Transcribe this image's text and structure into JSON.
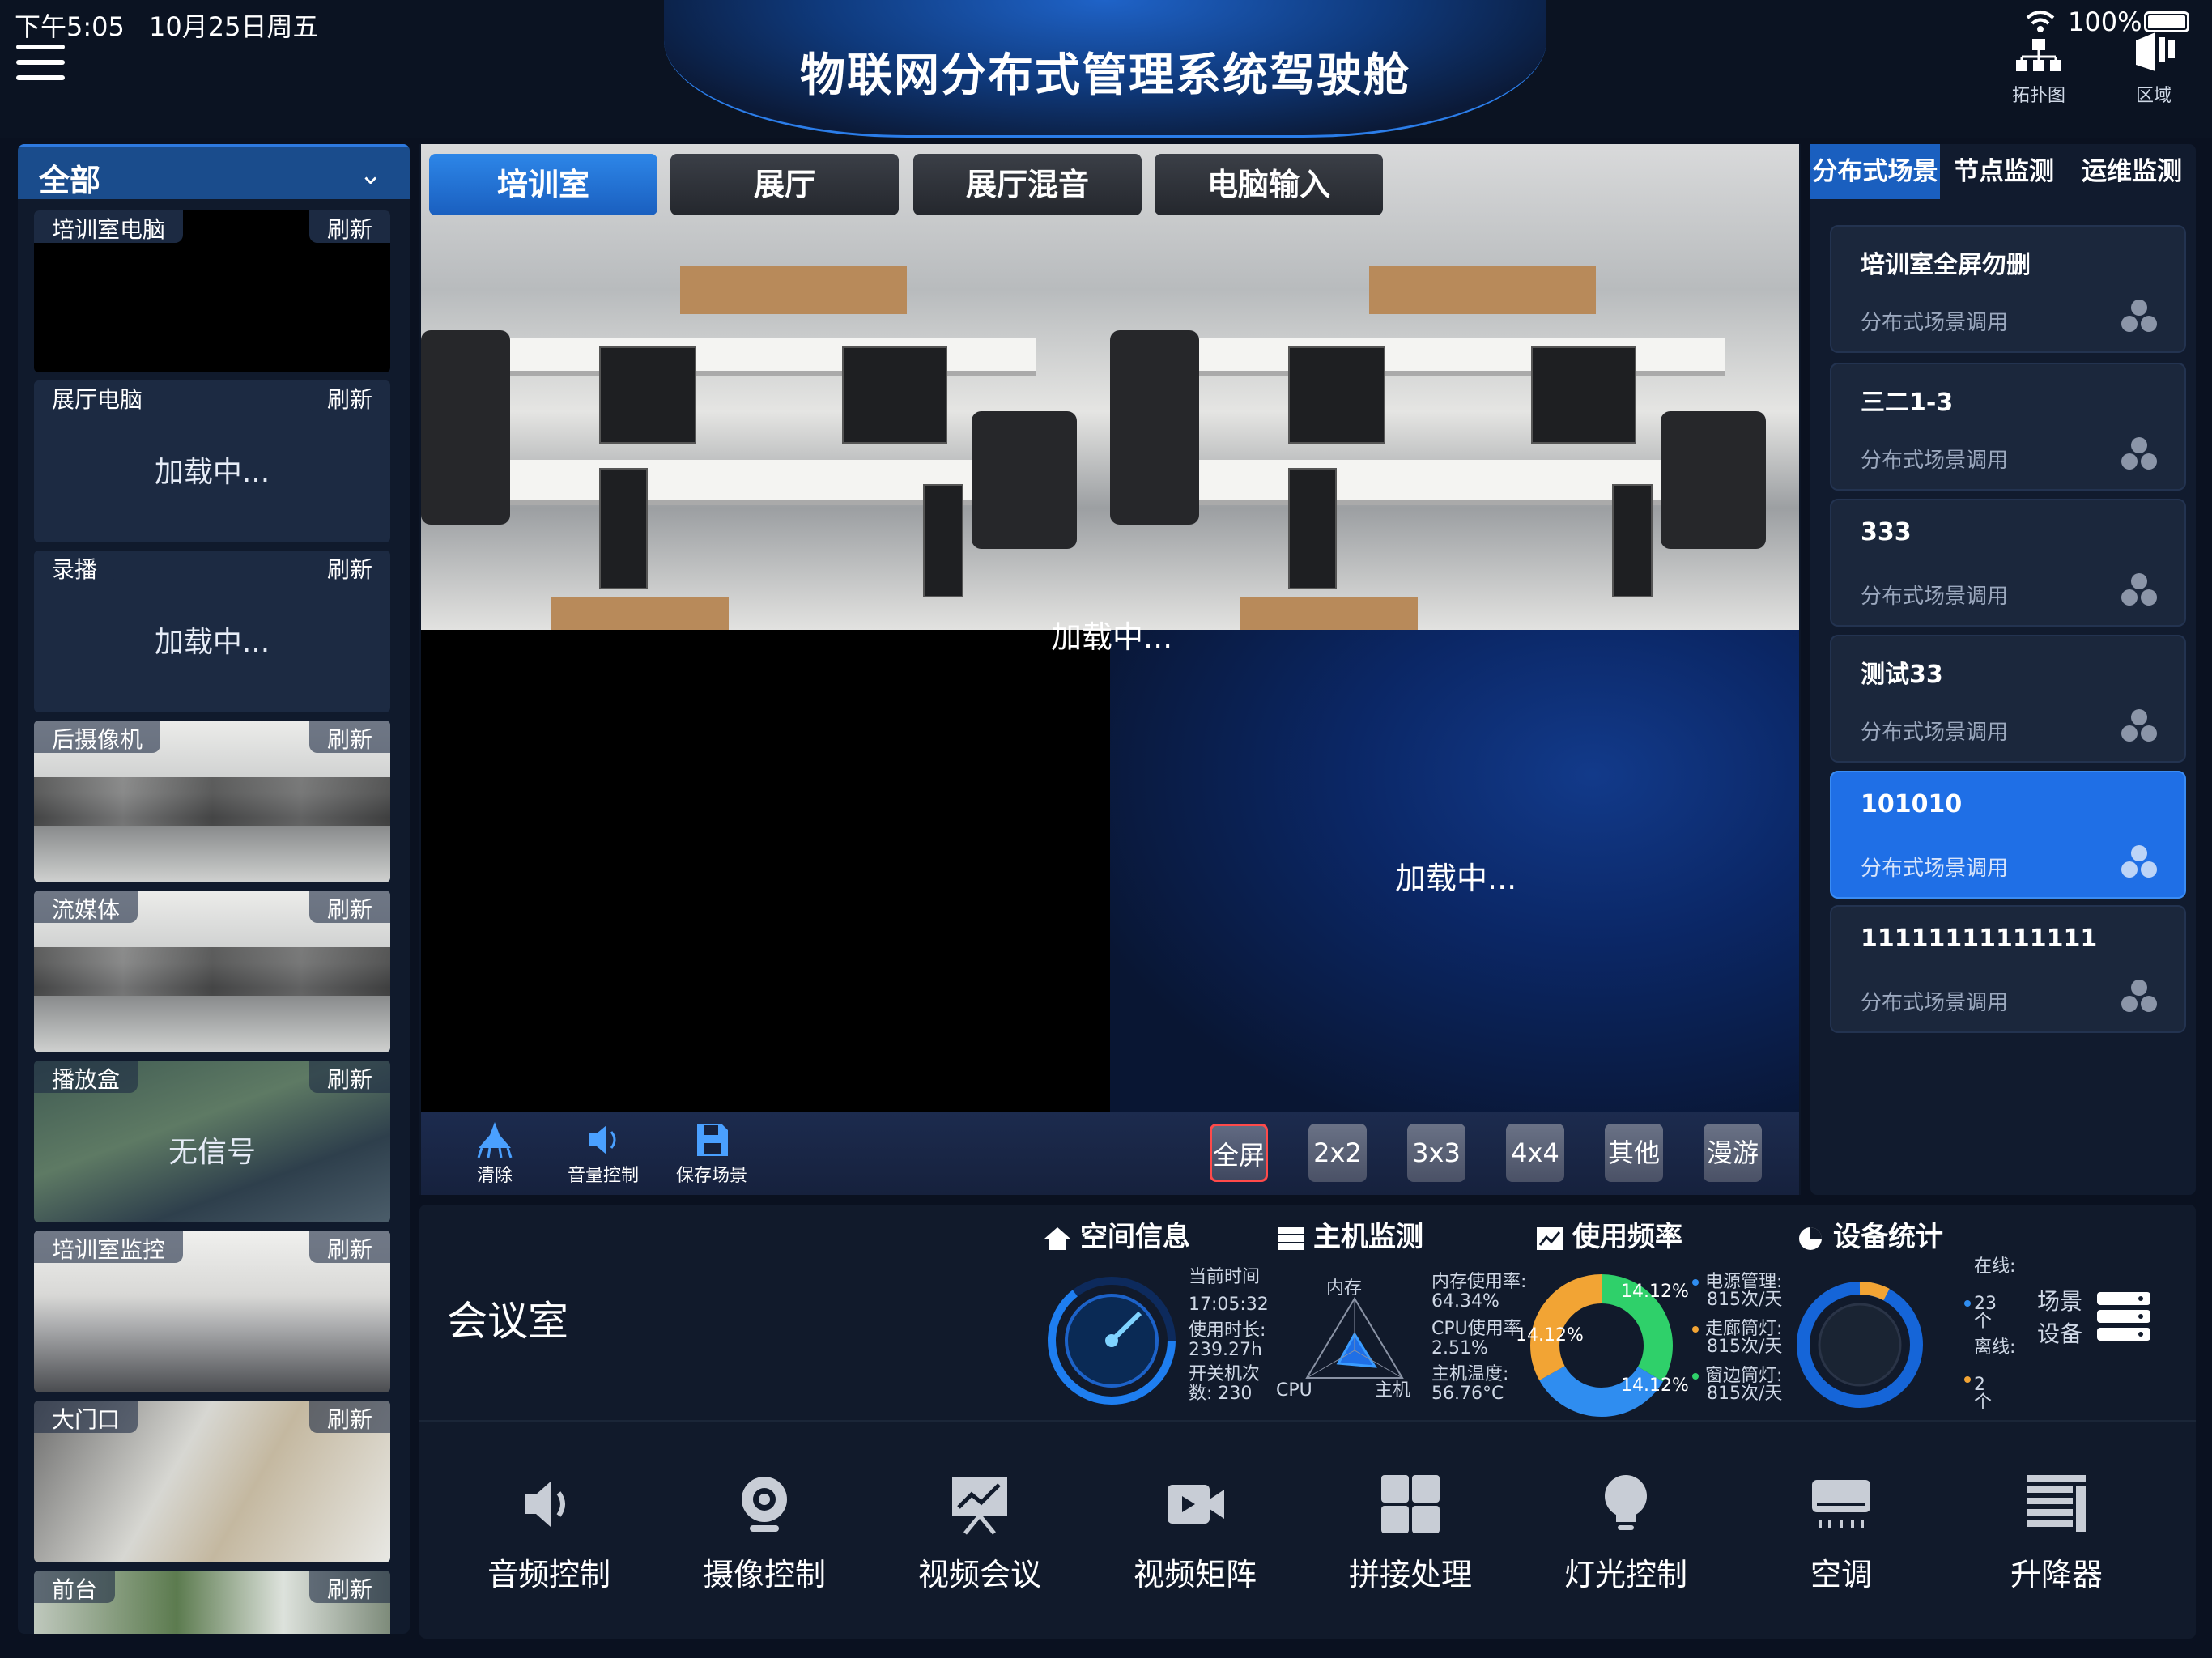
{
  "status": {
    "time": "下午5:05",
    "date": "10月25日周五",
    "battery": "100%"
  },
  "header": {
    "title": "物联网分布式管理系统驾驶舱",
    "topology_label": "拓扑图",
    "region_label": "区域"
  },
  "left": {
    "filter": "全部",
    "sources": [
      {
        "name": "培训室电脑",
        "refresh": "刷新",
        "message": ""
      },
      {
        "name": "展厅电脑",
        "refresh": "刷新",
        "message": "加载中..."
      },
      {
        "name": "录播",
        "refresh": "刷新",
        "message": "加载中..."
      },
      {
        "name": "后摄像机",
        "refresh": "刷新",
        "message": ""
      },
      {
        "name": "流媒体",
        "refresh": "刷新",
        "message": ""
      },
      {
        "name": "播放盒",
        "refresh": "刷新",
        "message": "无信号"
      },
      {
        "name": "培训室监控",
        "refresh": "刷新",
        "message": ""
      },
      {
        "name": "大门口",
        "refresh": "刷新",
        "message": ""
      },
      {
        "name": "前台",
        "refresh": "刷新",
        "message": ""
      }
    ]
  },
  "center": {
    "tabs": [
      "培训室",
      "展厅",
      "展厅混音",
      "电脑输入"
    ],
    "loading_top": "加载中...",
    "loading_right": "加载中...",
    "tools": [
      "清除",
      "音量控制",
      "保存场景"
    ],
    "layouts": [
      "全屏",
      "2x2",
      "3x3",
      "4x4",
      "其他",
      "漫游"
    ]
  },
  "right": {
    "tabs": [
      "分布式场景",
      "节点监测",
      "运维监测"
    ],
    "scenes": [
      {
        "name": "培训室全屏勿删",
        "sub": "分布式场景调用"
      },
      {
        "name": "三二1-3",
        "sub": "分布式场景调用"
      },
      {
        "name": "333",
        "sub": "分布式场景调用"
      },
      {
        "name": "测试33",
        "sub": "分布式场景调用"
      },
      {
        "name": "101010",
        "sub": "分布式场景调用"
      },
      {
        "name": "11111111111111",
        "sub": "分布式场景调用"
      }
    ],
    "active_scene": 4
  },
  "bottom": {
    "room": "会议室",
    "sections": [
      "空间信息",
      "主机监测",
      "使用频率",
      "设备统计"
    ],
    "space": {
      "current_time_label": "当前时间",
      "current_time": "17:05:32",
      "usage_label": "使用时长:",
      "usage": "239.27h",
      "switch_label": "开关机次",
      "switch": "数: 230"
    },
    "host": {
      "mem_axis": "内存",
      "cpu_axis": "CPU",
      "host_axis": "主机",
      "mem_label": "内存使用率:",
      "mem": "64.34%",
      "cpu_label": "CPU使用率",
      "cpu": "2.51%",
      "temp_label": "主机温度:",
      "temp": "56.76°C"
    },
    "freq": {
      "p1": "14.12%",
      "p2": "14.12%",
      "p3": "14.12%",
      "items": [
        {
          "label": "电源管理:",
          "value": "815次/天",
          "color": "#2f8df0"
        },
        {
          "label": "走廊筒灯:",
          "value": "815次/天",
          "color": "#f2a434"
        },
        {
          "label": "窗边筒灯:",
          "value": "815次/天",
          "color": "#2fd06a"
        }
      ]
    },
    "devices": {
      "online_label": "在线:",
      "online": "23个",
      "offline_label": "离线:",
      "offline": "2个",
      "online_fraction": 0.92,
      "scene_label": "场景",
      "device_label": "设备"
    },
    "controls": [
      "音频控制",
      "摄像控制",
      "视频会议",
      "视频矩阵",
      "拼接处理",
      "灯光控制",
      "空调",
      "升降器"
    ]
  }
}
